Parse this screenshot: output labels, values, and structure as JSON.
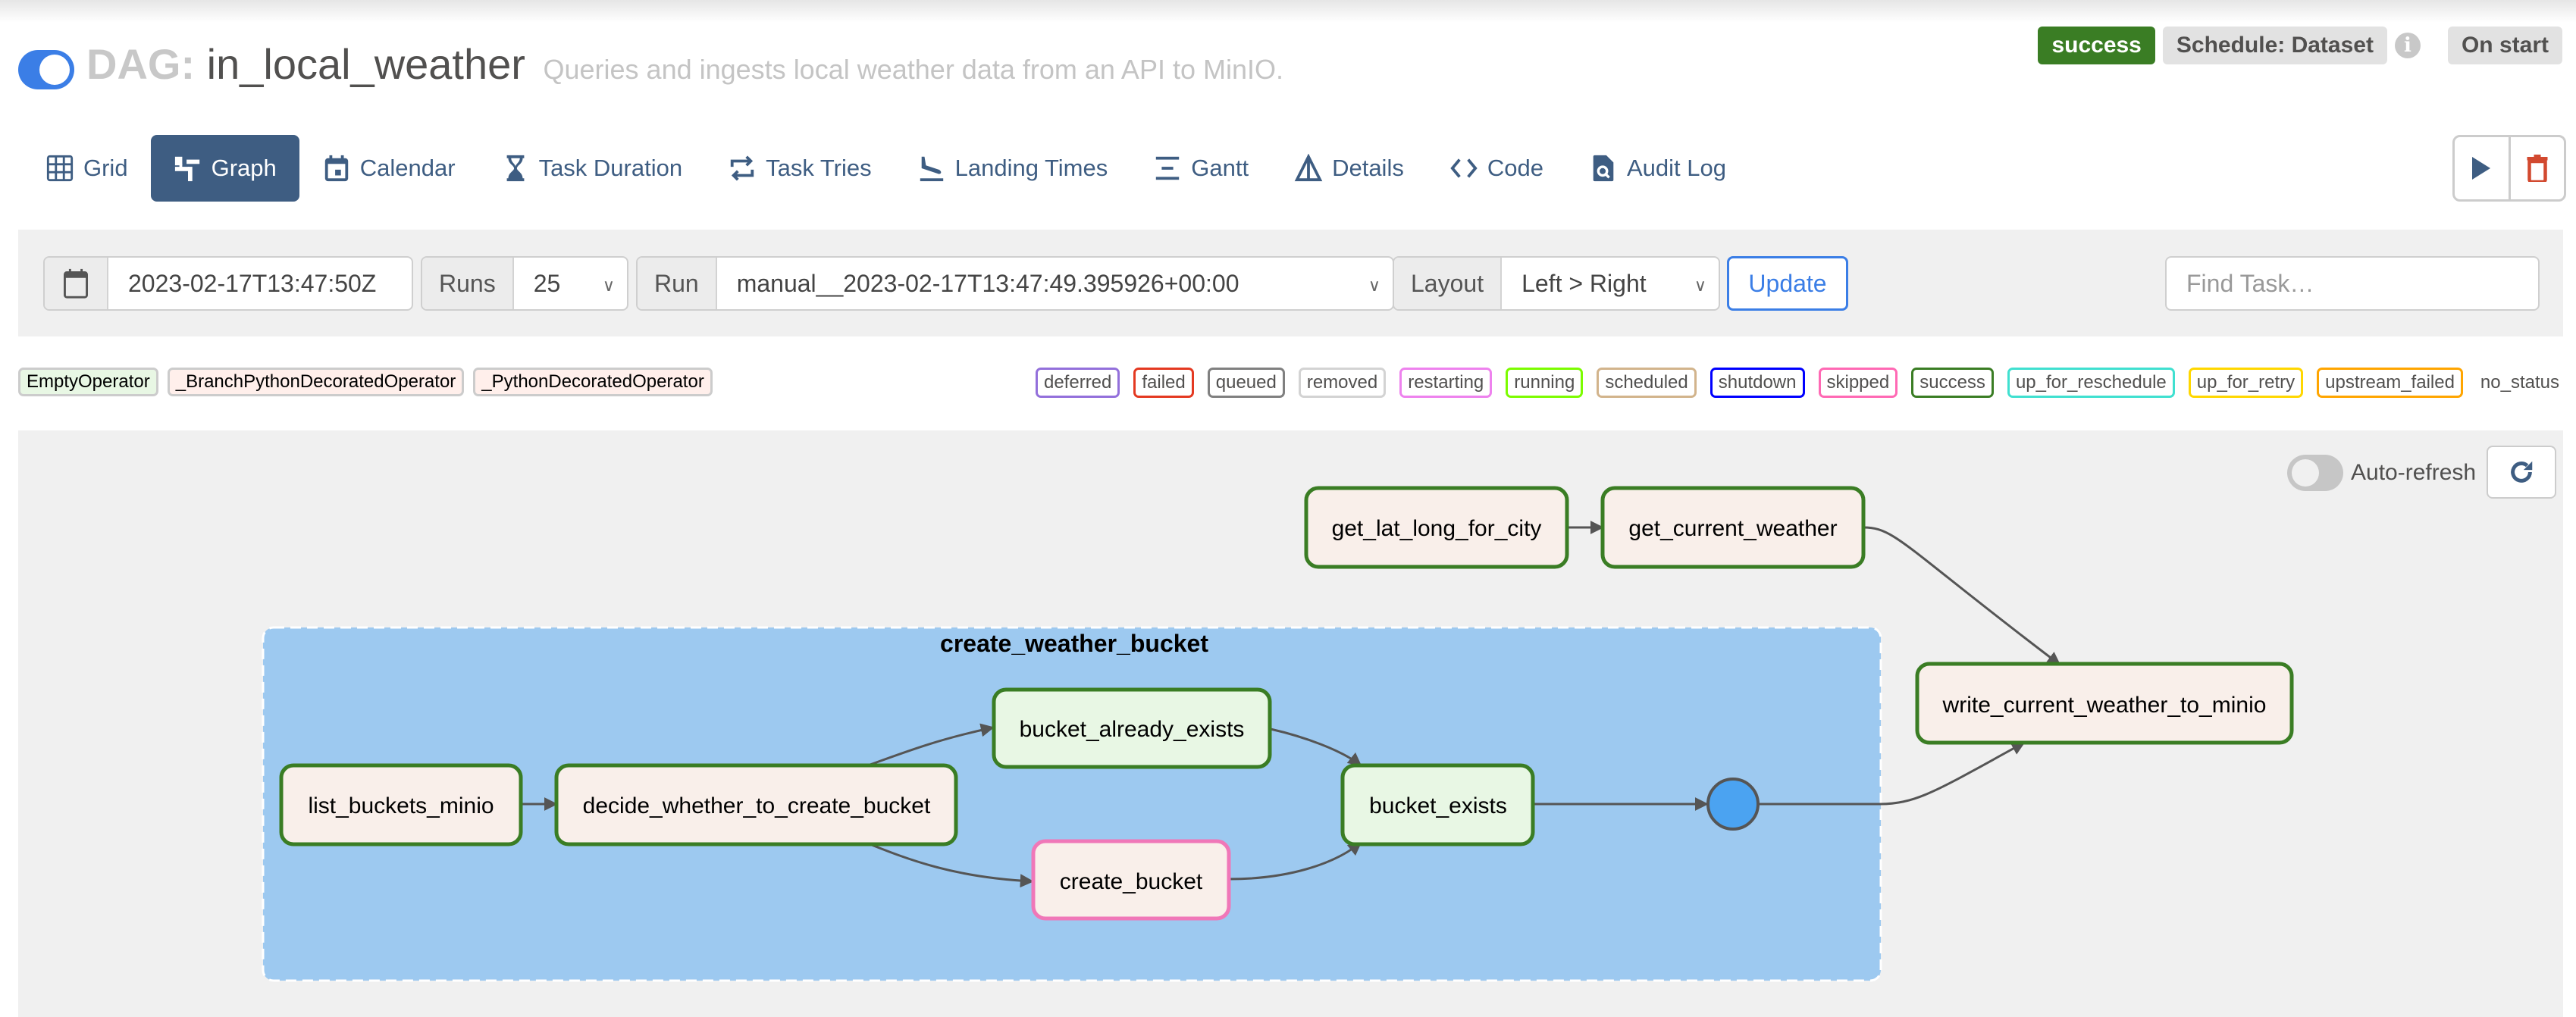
{
  "header": {
    "dag_prefix": "DAG:",
    "dag_id": "in_local_weather",
    "description": "Queries and ingests local weather data from an API to MinIO.",
    "dag_paused": false,
    "state_badge": "success",
    "schedule_badge": "Schedule: Dataset",
    "info_icon": "i",
    "on_start_badge": "On start"
  },
  "tabs": [
    {
      "label": "Grid",
      "icon": "grid-icon",
      "active": false
    },
    {
      "label": "Graph",
      "icon": "graph-icon",
      "active": true
    },
    {
      "label": "Calendar",
      "icon": "calendar-icon",
      "active": false
    },
    {
      "label": "Task Duration",
      "icon": "hourglass-icon",
      "active": false
    },
    {
      "label": "Task Tries",
      "icon": "retry-icon",
      "active": false
    },
    {
      "label": "Landing Times",
      "icon": "plane-landing-icon",
      "active": false
    },
    {
      "label": "Gantt",
      "icon": "gantt-icon",
      "active": false
    },
    {
      "label": "Details",
      "icon": "details-icon",
      "active": false
    },
    {
      "label": "Code",
      "icon": "code-icon",
      "active": false
    },
    {
      "label": "Audit Log",
      "icon": "audit-log-icon",
      "active": false
    }
  ],
  "actions": {
    "trigger_icon": "play-icon",
    "delete_icon": "trash-icon"
  },
  "filters": {
    "base_date": "2023-02-17T13:47:50Z",
    "runs_label": "Runs",
    "runs_value": "25",
    "run_label": "Run",
    "run_value": "manual__2023-02-17T13:47:49.395926+00:00",
    "layout_label": "Layout",
    "layout_value": "Left > Right",
    "update_label": "Update",
    "find_placeholder": "Find Task…"
  },
  "operator_legend": [
    {
      "label": "EmptyOperator",
      "color": "#e8f7e4"
    },
    {
      "label": "_BranchPythonDecoratedOperator",
      "color": "#ffefeb"
    },
    {
      "label": "_PythonDecoratedOperator",
      "color": "#ffefeb"
    }
  ],
  "state_legend": [
    {
      "label": "deferred",
      "color": "#9370db"
    },
    {
      "label": "failed",
      "color": "#e43921"
    },
    {
      "label": "queued",
      "color": "#808080"
    },
    {
      "label": "removed",
      "color": "#d3d3d3"
    },
    {
      "label": "restarting",
      "color": "#ee82ee"
    },
    {
      "label": "running",
      "color": "#7cfc00"
    },
    {
      "label": "scheduled",
      "color": "#d2b48c"
    },
    {
      "label": "shutdown",
      "color": "#0000ff"
    },
    {
      "label": "skipped",
      "color": "#ff69b4"
    },
    {
      "label": "success",
      "color": "#3a7d24"
    },
    {
      "label": "up_for_reschedule",
      "color": "#40e0d0"
    },
    {
      "label": "up_for_retry",
      "color": "#ffd700"
    },
    {
      "label": "upstream_failed",
      "color": "#ffa500"
    },
    {
      "label": "no_status",
      "color": ""
    }
  ],
  "graph": {
    "auto_refresh_label": "Auto-refresh",
    "auto_refresh_on": false,
    "refresh_icon": "refresh-icon",
    "group": {
      "label": "create_weather_bucket"
    },
    "nodes": [
      {
        "id": "get_lat_long_for_city",
        "label": "get_lat_long_for_city",
        "state": "success",
        "operator": "_PythonDecoratedOperator"
      },
      {
        "id": "get_current_weather",
        "label": "get_current_weather",
        "state": "success",
        "operator": "_PythonDecoratedOperator"
      },
      {
        "id": "write_current_weather_to_minio",
        "label": "write_current_weather_to_minio",
        "state": "success",
        "operator": "_PythonDecoratedOperator"
      },
      {
        "id": "list_buckets_minio",
        "label": "list_buckets_minio",
        "state": "success",
        "operator": "_PythonDecoratedOperator"
      },
      {
        "id": "decide_whether_to_create_bucket",
        "label": "decide_whether_to_create_bucket",
        "state": "success",
        "operator": "_BranchPythonDecoratedOperator"
      },
      {
        "id": "bucket_already_exists",
        "label": "bucket_already_exists",
        "state": "success",
        "operator": "EmptyOperator"
      },
      {
        "id": "create_bucket",
        "label": "create_bucket",
        "state": "skipped",
        "operator": "_PythonDecoratedOperator"
      },
      {
        "id": "bucket_exists",
        "label": "bucket_exists",
        "state": "success",
        "operator": "EmptyOperator"
      }
    ],
    "edges": [
      [
        "get_lat_long_for_city",
        "get_current_weather"
      ],
      [
        "get_current_weather",
        "write_current_weather_to_minio"
      ],
      [
        "list_buckets_minio",
        "decide_whether_to_create_bucket"
      ],
      [
        "decide_whether_to_create_bucket",
        "bucket_already_exists"
      ],
      [
        "decide_whether_to_create_bucket",
        "create_bucket"
      ],
      [
        "bucket_already_exists",
        "bucket_exists"
      ],
      [
        "create_bucket",
        "bucket_exists"
      ],
      [
        "bucket_exists",
        "group_join"
      ],
      [
        "group_join",
        "write_current_weather_to_minio"
      ]
    ]
  }
}
